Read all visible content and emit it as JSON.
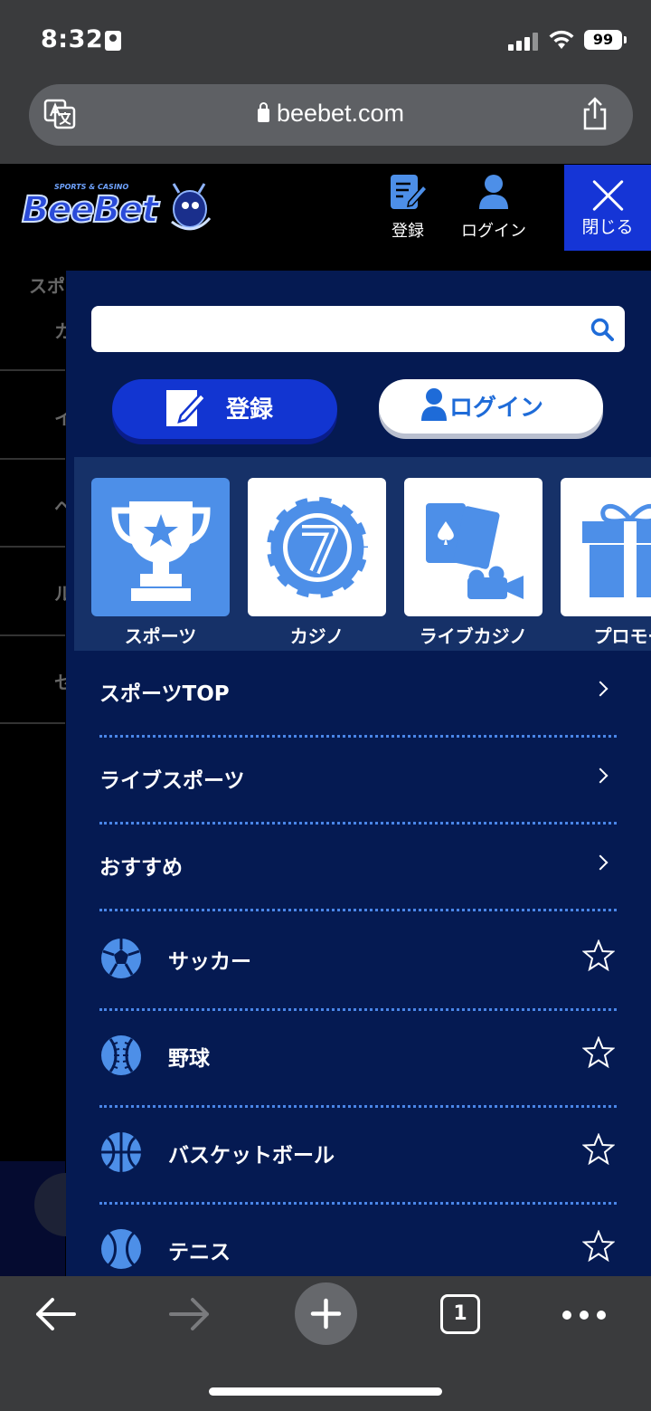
{
  "status_bar": {
    "time": "8:32",
    "battery": "99"
  },
  "browser": {
    "url": "beebet.com"
  },
  "header": {
    "logo_top_text": "SPORTS & CASINO",
    "logo_text": "BeeBet",
    "register_label": "登録",
    "login_label": "ログイン",
    "close_label": "閉じる"
  },
  "background_page": {
    "items": [
      "スポ",
      "カ",
      "イ",
      "ヘ",
      "ル",
      "セ"
    ]
  },
  "menu": {
    "search_placeholder": "",
    "register_button": "登録",
    "login_button": "ログイン",
    "categories": [
      {
        "label": "スポーツ",
        "icon": "trophy-icon",
        "active": true
      },
      {
        "label": "カジノ",
        "icon": "casino-chip-icon",
        "active": false
      },
      {
        "label": "ライブカジノ",
        "icon": "live-casino-icon",
        "active": false
      },
      {
        "label": "プロモー",
        "icon": "gift-icon",
        "active": false
      }
    ],
    "links": [
      {
        "label": "スポーツTOP"
      },
      {
        "label": "ライブスポーツ"
      },
      {
        "label": "おすすめ"
      }
    ],
    "sports": [
      {
        "label": "サッカー",
        "icon": "soccer-ball-icon"
      },
      {
        "label": "野球",
        "icon": "baseball-icon"
      },
      {
        "label": "バスケットボール",
        "icon": "basketball-icon"
      },
      {
        "label": "テニス",
        "icon": "tennis-ball-icon"
      }
    ]
  },
  "bottom_bar": {
    "tab_count": "1"
  },
  "colors": {
    "menu_bg": "#051a52",
    "accent_blue": "#1235d1",
    "icon_blue": "#4d8fe8",
    "divider": "#4a86e8"
  }
}
